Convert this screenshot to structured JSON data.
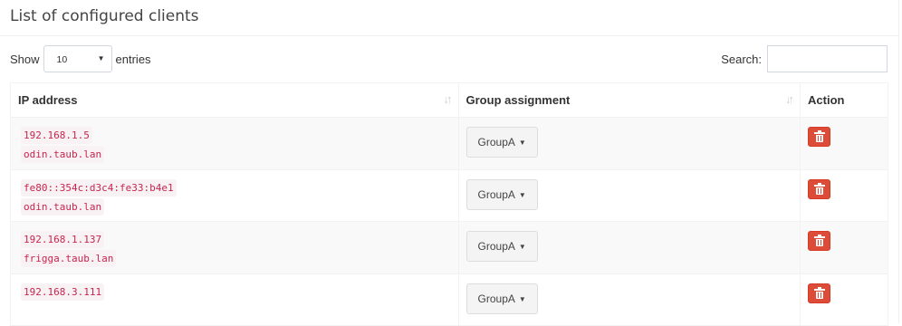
{
  "box": {
    "title": "List of configured clients"
  },
  "controls": {
    "show_label": "Show",
    "entries_value": "10",
    "entries_label": "entries",
    "search_label": "Search:",
    "search_value": ""
  },
  "table": {
    "headers": {
      "ip": "IP address",
      "group": "Group assignment",
      "action": "Action"
    },
    "rows": [
      {
        "ip": "192.168.1.5",
        "host": "odin.taub.lan",
        "group": "GroupA"
      },
      {
        "ip": "fe80::354c:d3c4:fe33:b4e1",
        "host": "odin.taub.lan",
        "group": "GroupA"
      },
      {
        "ip": "192.168.1.137",
        "host": "frigga.taub.lan",
        "group": "GroupA"
      },
      {
        "ip": "192.168.3.111",
        "host": "",
        "group": "GroupA"
      }
    ]
  },
  "icons": {
    "sort": "sort-icon",
    "caret": "caret-down-icon",
    "delete": "trash-icon"
  },
  "colors": {
    "delete_button": "#dd4b39",
    "code_text": "#c7254e",
    "code_bg": "#f9f2f4"
  }
}
